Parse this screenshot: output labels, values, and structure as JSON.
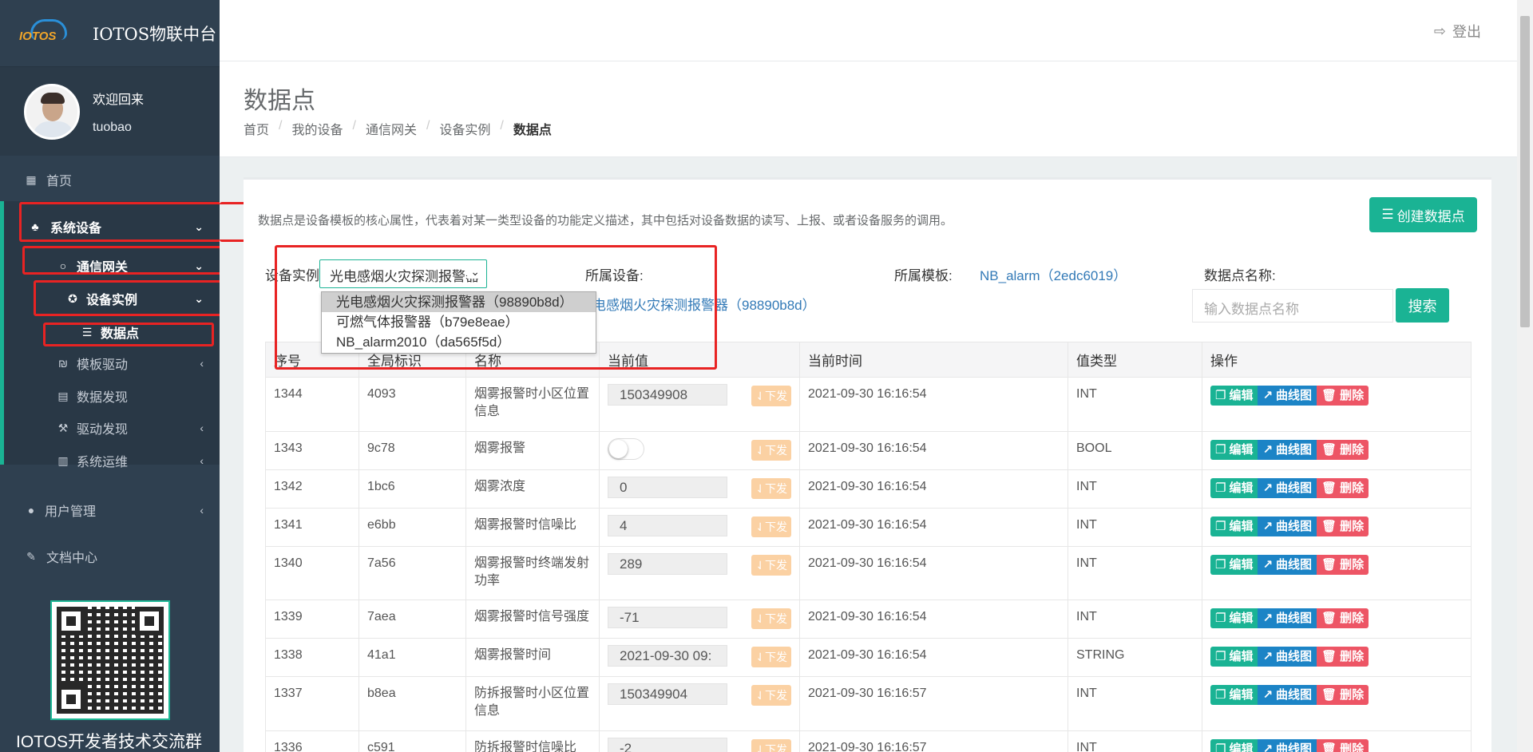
{
  "app": {
    "brand_logo_text": "IOTOS",
    "title": "IOTOS物联中台",
    "logout_label": "登出"
  },
  "profile": {
    "welcome": "欢迎回来",
    "username": "tuobao"
  },
  "sidebar": {
    "items": [
      {
        "label": "首页",
        "icon": "grid-icon"
      },
      {
        "label": "系统设备",
        "icon": "sitemap-icon"
      },
      {
        "label": "通信网关",
        "icon": "circle-icon"
      },
      {
        "label": "设备实例",
        "icon": "rebel-icon"
      },
      {
        "label": "数据点",
        "icon": "database-icon"
      },
      {
        "label": "模板驱动",
        "icon": "gg-icon"
      },
      {
        "label": "数据发现",
        "icon": "table-icon"
      },
      {
        "label": "驱动发现",
        "icon": "gavel-icon"
      },
      {
        "label": "系统运维",
        "icon": "bar-chart-icon"
      },
      {
        "label": "用户管理",
        "icon": "user-icon"
      },
      {
        "label": "文档中心",
        "icon": "edit-icon"
      }
    ],
    "qr_caption": "IOTOS开发者技术交流群"
  },
  "page": {
    "title": "数据点",
    "breadcrumb": [
      "首页",
      "我的设备",
      "通信网关",
      "设备实例",
      "数据点"
    ]
  },
  "panel": {
    "description": "数据点是设备模板的核心属性，代表着对某一类型设备的功能定义描述，其中包括对设备数据的读写、上报、或者设备服务的调用。",
    "create_button": "创建数据点",
    "device_instance_label": "设备实例",
    "device_instance_selected": "光电感烟火灾探测报警器（98890b8d）",
    "dropdown_options": [
      "光电感烟火灾探测报警器（98890b8d）",
      "可燃气体报警器（b79e8eae）",
      "NB_alarm2010（da565f5d）"
    ],
    "owner_device_label": "所属设备:",
    "owner_device_value": "光电感烟火灾探测报警器（98890b8d）",
    "owner_template_label": "所属模板:",
    "owner_template_value": "NB_alarm（2edc6019）",
    "point_name_label": "数据点名称:",
    "point_name_placeholder": "输入数据点名称",
    "search_button": "搜索"
  },
  "table": {
    "headers": [
      "序号",
      "全局标识",
      "名称",
      "当前值",
      "当前时间",
      "值类型",
      "操作"
    ],
    "issue_label": "下发",
    "ops": {
      "edit": "编辑",
      "curve": "曲线图",
      "delete": "删除"
    },
    "rows": [
      {
        "id": "1344",
        "gid": "4093",
        "name": "烟雾报警时小区位置信息",
        "value": "150349908",
        "time": "2021-09-30 16:16:54",
        "type": "INT"
      },
      {
        "id": "1343",
        "gid": "9c78",
        "name": "烟雾报警",
        "value": "",
        "toggle": true,
        "time": "2021-09-30 16:16:54",
        "type": "BOOL"
      },
      {
        "id": "1342",
        "gid": "1bc6",
        "name": "烟雾浓度",
        "value": "0",
        "time": "2021-09-30 16:16:54",
        "type": "INT"
      },
      {
        "id": "1341",
        "gid": "e6bb",
        "name": "烟雾报警时信噪比",
        "value": "4",
        "time": "2021-09-30 16:16:54",
        "type": "INT"
      },
      {
        "id": "1340",
        "gid": "7a56",
        "name": "烟雾报警时终端发射功率",
        "value": "289",
        "time": "2021-09-30 16:16:54",
        "type": "INT"
      },
      {
        "id": "1339",
        "gid": "7aea",
        "name": "烟雾报警时信号强度",
        "value": "-71",
        "time": "2021-09-30 16:16:54",
        "type": "INT"
      },
      {
        "id": "1338",
        "gid": "41a1",
        "name": "烟雾报警时间",
        "value": "2021-09-30 09:",
        "time": "2021-09-30 16:16:54",
        "type": "STRING"
      },
      {
        "id": "1337",
        "gid": "b8ea",
        "name": "防拆报警时小区位置信息",
        "value": "150349904",
        "time": "2021-09-30 16:16:57",
        "type": "INT"
      },
      {
        "id": "1336",
        "gid": "c591",
        "name": "防拆报警时信噪比",
        "value": "-2",
        "time": "2021-09-30 16:16:57",
        "type": "INT"
      }
    ]
  }
}
